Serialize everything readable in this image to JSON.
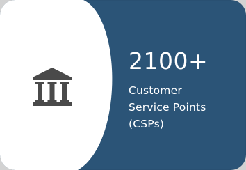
{
  "stat": {
    "number": "2100+",
    "label_lines": [
      "Customer",
      "Service Points",
      "(CSPs)"
    ]
  },
  "icon": {
    "name": "bank-building-icon",
    "color": "#4a4a4a"
  },
  "colors": {
    "card_blue": "#2b5477",
    "panel_white": "#ffffff",
    "page_gray": "#d2d2d2",
    "text": "#ffffff"
  }
}
